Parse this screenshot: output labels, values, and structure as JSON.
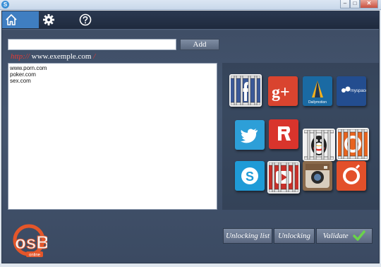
{
  "window": {
    "icon_letter": "S",
    "minimize": "–",
    "maximize": "□",
    "close": "✕"
  },
  "nav": {
    "items": [
      {
        "name": "home",
        "icon": "home-icon"
      },
      {
        "name": "settings",
        "icon": "gear-icon"
      },
      {
        "name": "help",
        "icon": "question-icon"
      }
    ]
  },
  "url_entry": {
    "value": "",
    "placeholder": "",
    "add_label": "Add"
  },
  "hint": {
    "prefix": "http://",
    "example": " www.exemple.com ",
    "suffix": "/"
  },
  "blocked_sites": [
    "www.porn.com",
    "poker.com",
    "sex.com"
  ],
  "tiles": [
    {
      "name": "facebook-tile",
      "color": "#3b5998",
      "jailed": true
    },
    {
      "name": "google-plus-tile",
      "color": "#d9442f",
      "jailed": false
    },
    {
      "name": "dailymotion-tile",
      "color": "#1a6aa3",
      "jailed": false,
      "label": "Dailymotion"
    },
    {
      "name": "myspace-tile",
      "color": "#234d8f",
      "jailed": false,
      "label": "myspace"
    },
    {
      "name": "twitter-tile",
      "color": "#2d9fd8",
      "jailed": false
    },
    {
      "name": "roblox-tile",
      "color": "#d9342c",
      "jailed": false
    },
    {
      "name": "qq-tile",
      "color": "#222222",
      "jailed": true
    },
    {
      "name": "origin-tile",
      "color": "#e8641f",
      "jailed": true
    },
    {
      "name": "skype-tile",
      "color": "#1f9bd7",
      "jailed": false
    },
    {
      "name": "youtube-tile",
      "color": "#c8302a",
      "jailed": true
    },
    {
      "name": "instagram-tile",
      "color": "#8a6a4c",
      "jailed": false
    },
    {
      "name": "origin2-tile",
      "color": "#e3502a",
      "jailed": false
    }
  ],
  "buttons": {
    "unlocking_list": "Unlocking list",
    "unlocking": "Unlocking",
    "validate": "Validate"
  },
  "logo": {
    "text": "osB",
    "sub": "online"
  },
  "colors": {
    "nav_active": "#3f7ec1",
    "panel": "#455670",
    "validate_check": "#6ad34a"
  }
}
